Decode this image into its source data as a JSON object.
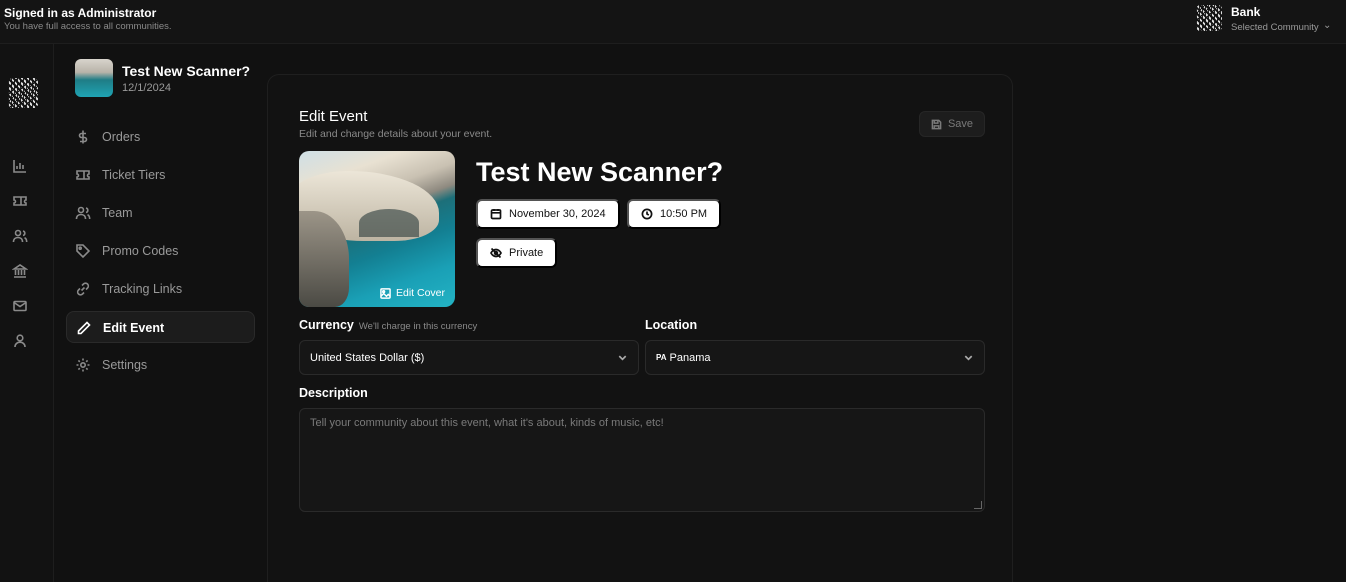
{
  "topbar": {
    "signed_in_title": "Signed in as Administrator",
    "signed_in_subtitle": "You have full access to all communities.",
    "community_name": "Bank",
    "community_label": "Selected Community"
  },
  "rail": {
    "icons": [
      "chart-icon",
      "ticket-icon",
      "users-icon",
      "bank-icon",
      "mail-icon",
      "user-icon"
    ]
  },
  "sidebar": {
    "event_name": "Test New Scanner?",
    "event_date": "12/1/2024",
    "items": [
      {
        "label": "Orders",
        "icon": "dollar-icon",
        "active": false
      },
      {
        "label": "Ticket Tiers",
        "icon": "ticket-icon",
        "active": false
      },
      {
        "label": "Team",
        "icon": "users-icon",
        "active": false
      },
      {
        "label": "Promo Codes",
        "icon": "tag-icon",
        "active": false
      },
      {
        "label": "Tracking Links",
        "icon": "link-icon",
        "active": false
      },
      {
        "label": "Edit Event",
        "icon": "pencil-icon",
        "active": true
      },
      {
        "label": "Settings",
        "icon": "gear-icon",
        "active": false
      }
    ]
  },
  "main": {
    "title": "Edit Event",
    "subtitle": "Edit and change details about your event.",
    "save_label": "Save",
    "edit_cover_label": "Edit Cover",
    "event_title": "Test New Scanner?",
    "date_label": "November 30, 2024",
    "time_label": "10:50 PM",
    "visibility_label": "Private",
    "currency": {
      "label": "Currency",
      "hint": "We'll charge in this currency",
      "value": "United States Dollar ($)"
    },
    "location": {
      "label": "Location",
      "flag_code": "PA",
      "value": "Panama"
    },
    "description": {
      "label": "Description",
      "placeholder": "Tell your community about this event, what it's about, kinds of music, etc!"
    }
  }
}
